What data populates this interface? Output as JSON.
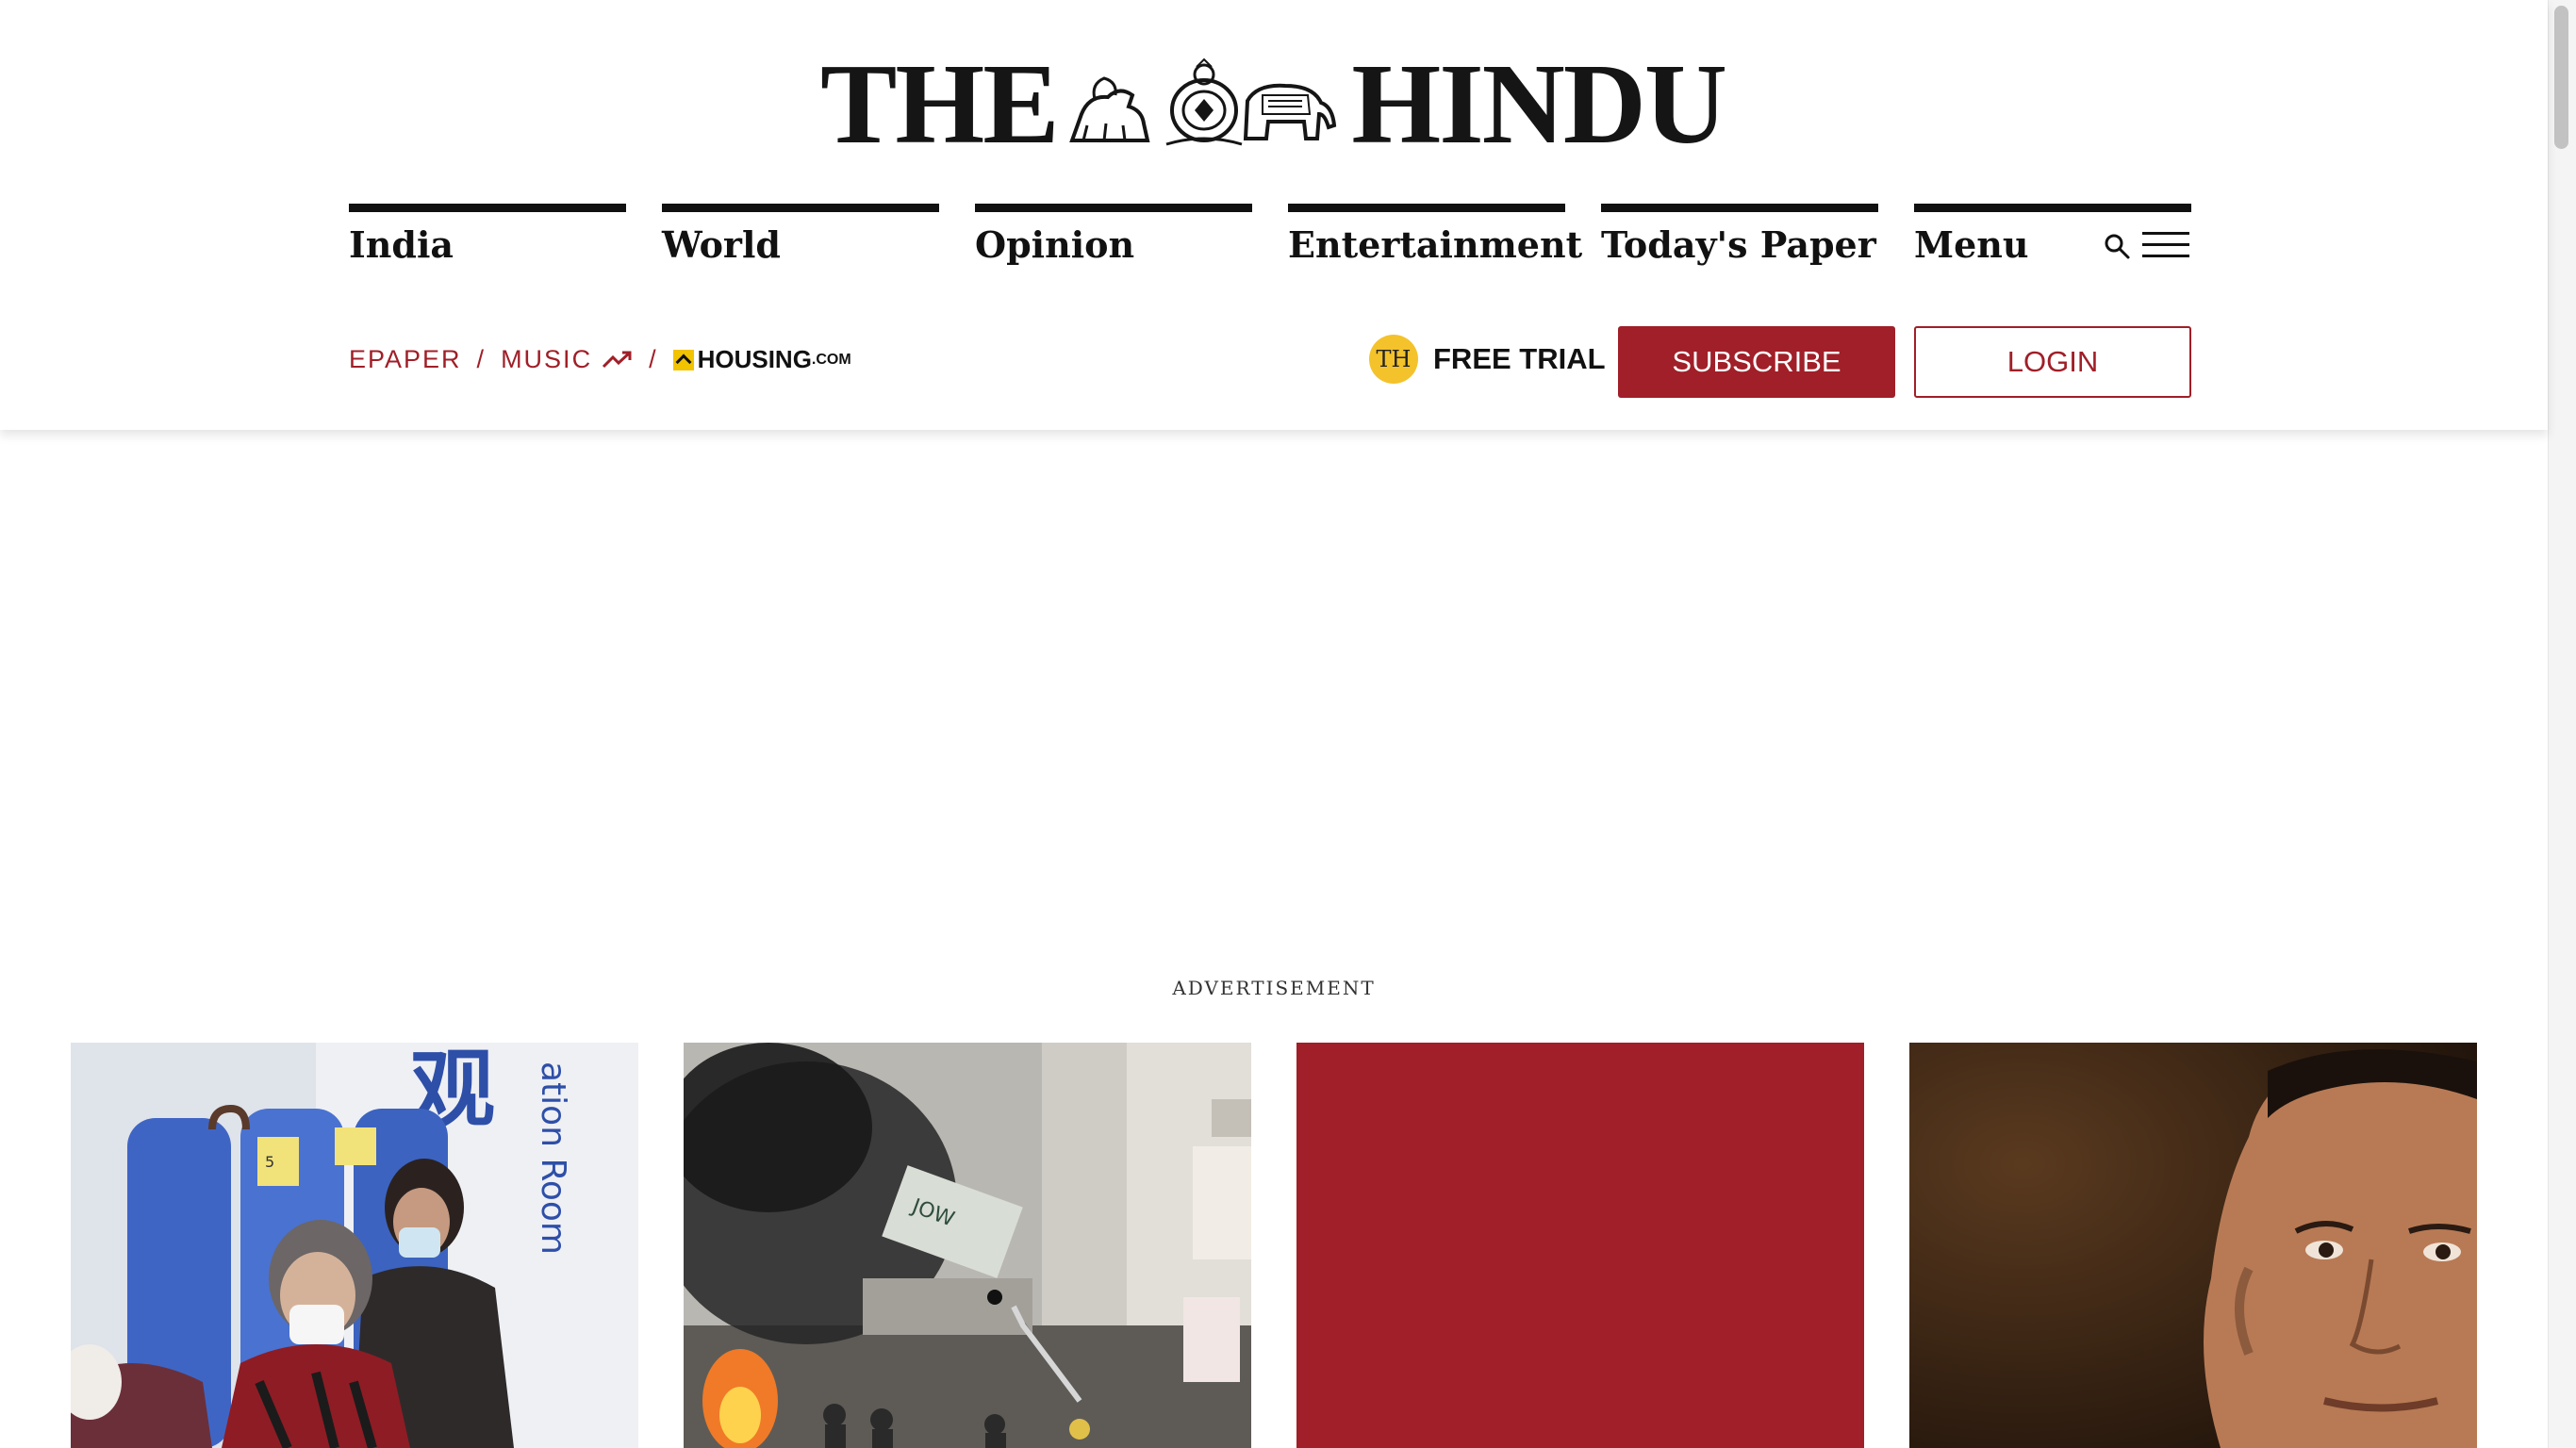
{
  "logo": {
    "left_word": "THE",
    "right_word": "HINDU"
  },
  "nav": {
    "items": [
      {
        "label": "India"
      },
      {
        "label": "World"
      },
      {
        "label": "Opinion"
      },
      {
        "label": "Entertainment"
      },
      {
        "label": "Today's Paper"
      },
      {
        "label": "Menu"
      }
    ]
  },
  "sub_links": {
    "epaper": "EPAPER",
    "separator": "/",
    "music": "MUSIC",
    "housing_main": "HOUSING",
    "housing_suffix": ".COM"
  },
  "trial": {
    "badge": "TH",
    "label": "FREE TRIAL"
  },
  "buttons": {
    "subscribe": "SUBSCRIBE",
    "login": "LOGIN"
  },
  "ad": {
    "label": "ADVERTISEMENT"
  },
  "cards": [
    {
      "image": "hospital-ward-photo",
      "image_text_1": "观",
      "image_text_2": "ation Room",
      "sign": "5"
    },
    {
      "image": "street-fire-photo",
      "sign": "JOW"
    },
    {
      "image": "red-placeholder"
    },
    {
      "image": "politician-portrait-photo"
    }
  ],
  "colors": {
    "brand_red": "#a01f28",
    "trial_yellow": "#f4c22b",
    "nav_rule": "#111111"
  }
}
